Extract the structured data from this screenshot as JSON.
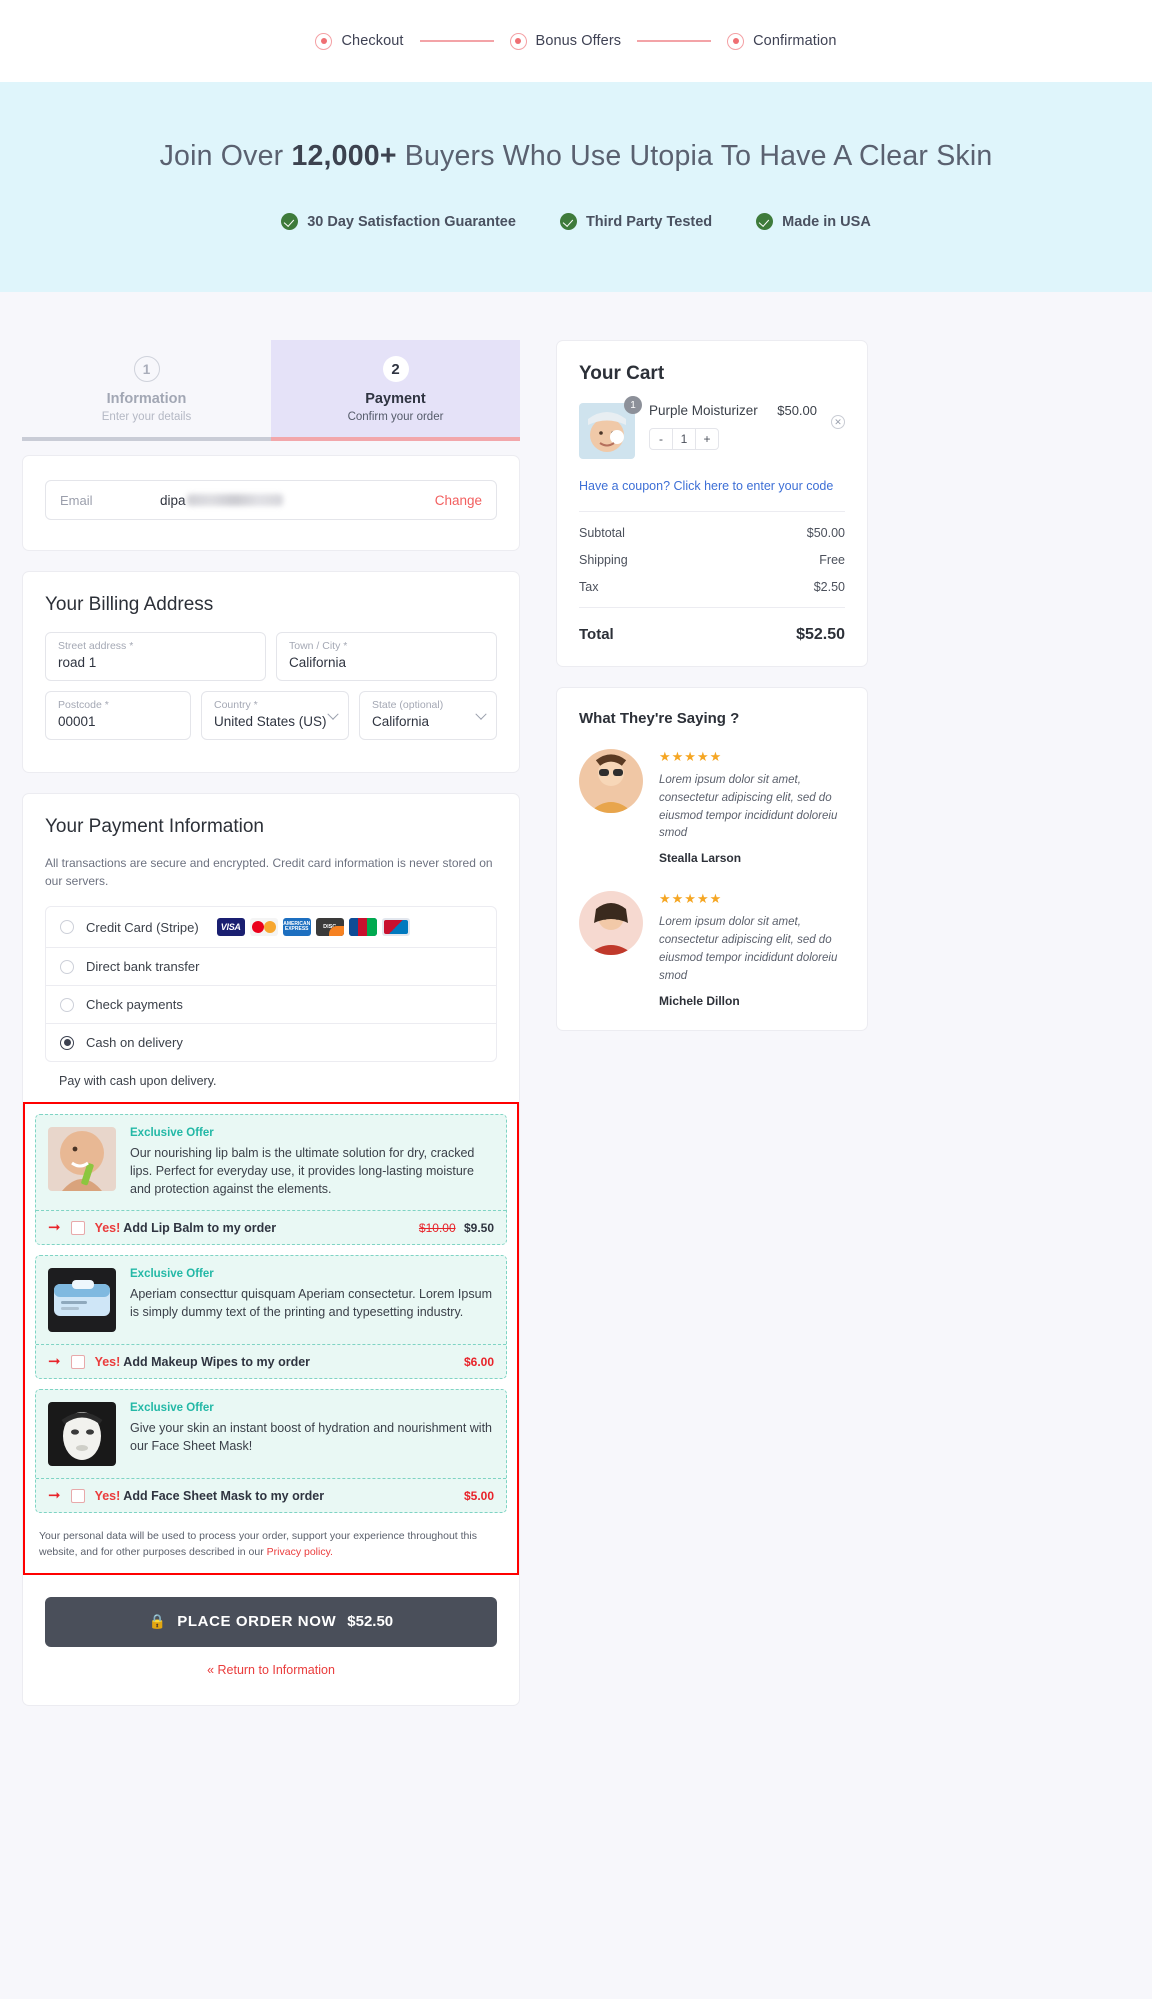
{
  "progress": {
    "steps": [
      {
        "label": "Checkout",
        "icon": "radio-dot-icon"
      },
      {
        "label": "Bonus Offers",
        "icon": "radio-dot-icon"
      },
      {
        "label": "Confirmation",
        "icon": "radio-dot-icon"
      }
    ]
  },
  "hero": {
    "heading_pre": "Join Over ",
    "heading_bold": "12,000+",
    "heading_post": " Buyers Who Use Utopia To Have A Clear Skin",
    "badges": [
      "30 Day Satisfaction Guarantee",
      "Third Party Tested",
      "Made in USA"
    ]
  },
  "tabs": [
    {
      "num": "1",
      "title": "Information",
      "sub": "Enter your details",
      "state": "inactive"
    },
    {
      "num": "2",
      "title": "Payment",
      "sub": "Confirm your order",
      "state": "active"
    }
  ],
  "email": {
    "label": "Email",
    "value": "dipa",
    "change_label": "Change"
  },
  "billing": {
    "title": "Your Billing Address",
    "fields": [
      {
        "label": "Street address *",
        "value": "road 1",
        "type": "text"
      },
      {
        "label": "Town / City *",
        "value": "California",
        "type": "text"
      },
      {
        "label": "Postcode *",
        "value": "00001",
        "type": "text"
      },
      {
        "label": "Country *",
        "value": "United States (US)",
        "type": "select"
      },
      {
        "label": "State (optional)",
        "value": "California",
        "type": "select"
      }
    ]
  },
  "payment": {
    "title": "Your Payment Information",
    "note": "All transactions are secure and encrypted. Credit card information is never stored on our servers.",
    "methods": [
      {
        "label": "Credit Card (Stripe)",
        "selected": false,
        "cards": [
          "VISA",
          "Mastercard",
          "American Express",
          "Discover",
          "JCB",
          "Diners Club"
        ]
      },
      {
        "label": "Direct bank transfer",
        "selected": false,
        "cards": []
      },
      {
        "label": "Check payments",
        "selected": false,
        "cards": []
      },
      {
        "label": "Cash on delivery",
        "selected": true,
        "cards": []
      }
    ],
    "selected_description": "Pay with cash upon delivery."
  },
  "offers": [
    {
      "tag": "Exclusive Offer",
      "description": "Our nourishing lip balm is the ultimate solution for dry, cracked lips. Perfect for everyday use, it provides long-lasting moisture and protection against the elements.",
      "cta_yes": "Yes!",
      "cta_text": " Add Lip Balm to my order",
      "price_old": "$10.00",
      "price_new": "$9.50",
      "checked": false
    },
    {
      "tag": "Exclusive Offer",
      "description": "Aperiam consecttur quisquam Aperiam consectetur. Lorem Ipsum is simply dummy text of the printing and typesetting industry.",
      "cta_yes": "Yes!",
      "cta_text": " Add Makeup Wipes to my order",
      "price_old": "",
      "price_new": "$6.00",
      "checked": false
    },
    {
      "tag": "Exclusive Offer",
      "description": "Give your skin an instant boost of hydration and nourishment with our Face Sheet Mask!",
      "cta_yes": "Yes!",
      "cta_text": " Add Face Sheet Mask to my order",
      "price_old": "",
      "price_new": "$5.00",
      "checked": false
    }
  ],
  "privacy": {
    "text_before": "Your personal data will be used to process your order, support your experience throughout this website, and for other purposes described in our ",
    "link": "Privacy policy.",
    "text_after": ""
  },
  "place_order": {
    "icon": "lock-icon",
    "label": "PLACE ORDER NOW",
    "amount": "$52.50",
    "return_link": "« Return to Information"
  },
  "cart": {
    "title": "Your Cart",
    "item": {
      "name": "Purple Moisturizer",
      "price": "$50.00",
      "qty": "1",
      "qty_badge": "1",
      "minus": "-",
      "plus": "+",
      "remove_icon": "close-circle-icon"
    },
    "coupon_link": "Have a coupon? Click here to enter your code",
    "lines": [
      {
        "label": "Subtotal",
        "value": "$50.00"
      },
      {
        "label": "Shipping",
        "value": "Free"
      },
      {
        "label": "Tax",
        "value": "$2.50"
      }
    ],
    "total_label": "Total",
    "total_value": "$52.50"
  },
  "testimonials": {
    "title": "What They're Saying ?",
    "items": [
      {
        "stars": "★★★★★",
        "text": "Lorem ipsum dolor sit amet, consectetur adipiscing elit, sed do eiusmod tempor incididunt doloreiu smod",
        "name": "Stealla Larson"
      },
      {
        "stars": "★★★★★",
        "text": "Lorem ipsum dolor sit amet, consectetur adipiscing elit, sed do eiusmod tempor incididunt doloreiu smod",
        "name": "Michele Dillon"
      }
    ]
  },
  "colors": {
    "accent_pink": "#f2a7ab",
    "hero_bg": "#dff5fb",
    "offer_border": "#ff0000",
    "offer_bg": "#e9f8f4",
    "order_button": "#4a4f5a",
    "link_blue": "#3d6fd6",
    "star": "#f5a623"
  }
}
